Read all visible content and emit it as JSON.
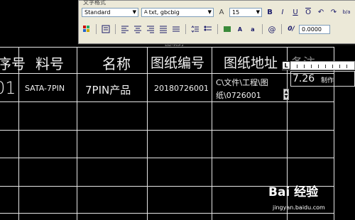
{
  "toolbar": {
    "title": "文字格式",
    "style_value": "Standard",
    "font_value": "txt, gbcbig",
    "height_icon": "A",
    "height_value": "15",
    "bold_label": "B",
    "italic_label": "I",
    "underline_label": "U",
    "overline_label": "O",
    "undo_icon": "↶",
    "redo_icon": "↷",
    "fraction_label": "b/a",
    "oblique_label": "0/",
    "oblique_value": "0.0000",
    "colors": {
      "accent": "#1a1a6a",
      "bg": "#ece9d8"
    }
  },
  "table": {
    "headers": [
      "序号",
      "料号",
      "名称",
      "图纸编号",
      "图纸地址",
      "备注"
    ],
    "row1": {
      "index": "01",
      "part_no": "SATA-7PIN",
      "name": "7PIN产品",
      "drawing_no": "20180726001",
      "drawing_addr_line1": "C\\文件\\工程\\图",
      "drawing_addr_line2": "纸\\0726001"
    },
    "top_partial_text": "图纸封"
  },
  "editor": {
    "ruler_tab": "L",
    "edit_value": "7.26",
    "edit_suffix": "制作"
  },
  "watermark": {
    "brand": "Bai 经验",
    "url": "jingyan.baidu.com"
  }
}
